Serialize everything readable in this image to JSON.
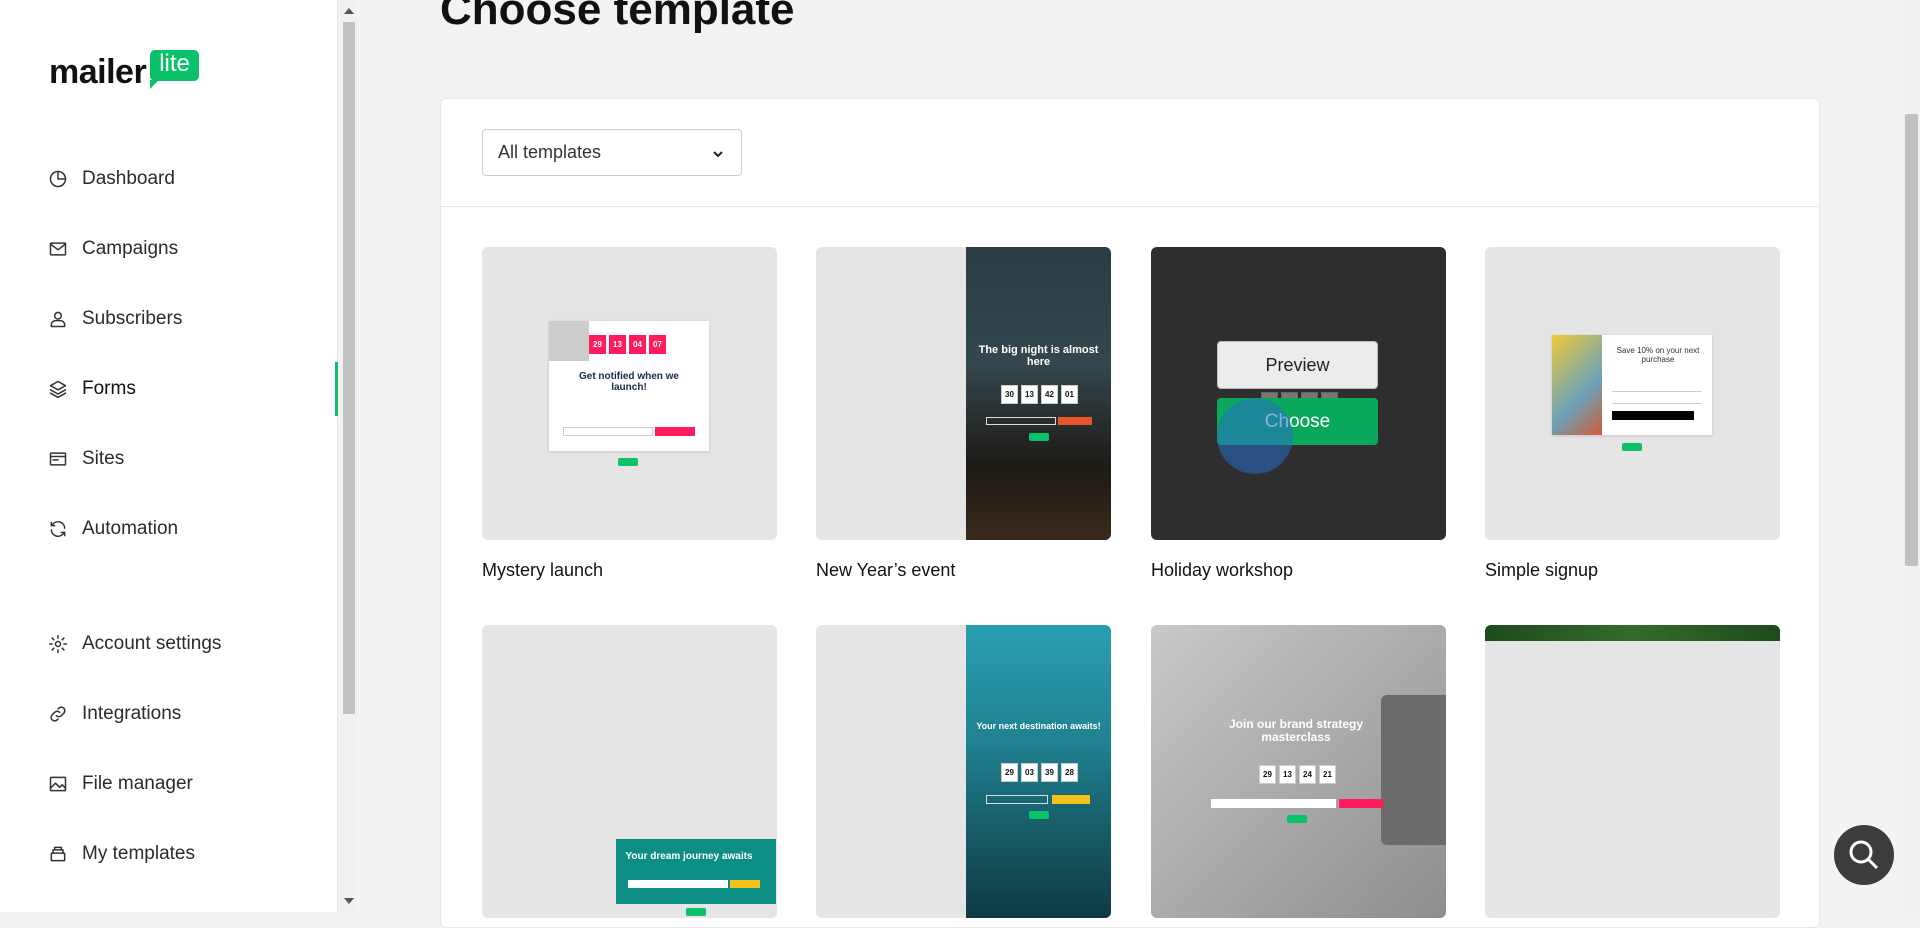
{
  "brand": {
    "word": "mailer",
    "badge": "lite",
    "accent": "#09c269"
  },
  "sidebar": {
    "items": [
      {
        "label": "Dashboard",
        "icon": "clock-icon"
      },
      {
        "label": "Campaigns",
        "icon": "mail-icon"
      },
      {
        "label": "Subscribers",
        "icon": "user-icon"
      },
      {
        "label": "Forms",
        "icon": "layers-icon",
        "active": true
      },
      {
        "label": "Sites",
        "icon": "browser-icon"
      },
      {
        "label": "Automation",
        "icon": "refresh-icon"
      },
      {
        "label": "Account settings",
        "icon": "gear-icon"
      },
      {
        "label": "Integrations",
        "icon": "link-icon"
      },
      {
        "label": "File manager",
        "icon": "image-icon"
      },
      {
        "label": "My templates",
        "icon": "stack-icon"
      }
    ]
  },
  "page": {
    "title": "Choose template"
  },
  "filter": {
    "selected": "All templates"
  },
  "templates": [
    {
      "name": "Mystery launch",
      "preview": {
        "digits": [
          "29",
          "13",
          "04",
          "07"
        ],
        "headline": "Get notified when we launch!"
      }
    },
    {
      "name": "New Year’s event",
      "preview": {
        "digits": [
          "30",
          "13",
          "42",
          "01"
        ],
        "headline": "The big night is almost here"
      }
    },
    {
      "name": "Holiday workshop",
      "preview": {
        "digits": [
          "29",
          "13",
          "24",
          "48"
        ]
      }
    },
    {
      "name": "Simple signup",
      "preview": {
        "headline": "Save 10% on your next purchase"
      }
    },
    {
      "name": "",
      "preview": {
        "headline": "Your dream journey awaits"
      }
    },
    {
      "name": "",
      "preview": {
        "digits": [
          "29",
          "03",
          "39",
          "28"
        ],
        "headline": "Your next destination awaits!"
      }
    },
    {
      "name": "",
      "preview": {
        "digits": [
          "29",
          "13",
          "24",
          "21"
        ],
        "headline": "Join our brand strategy masterclass"
      }
    },
    {
      "name": "",
      "preview": {}
    }
  ],
  "hover_actions": {
    "preview_label": "Preview",
    "choose_label": "Choose"
  },
  "help": {
    "icon": "search-icon"
  }
}
